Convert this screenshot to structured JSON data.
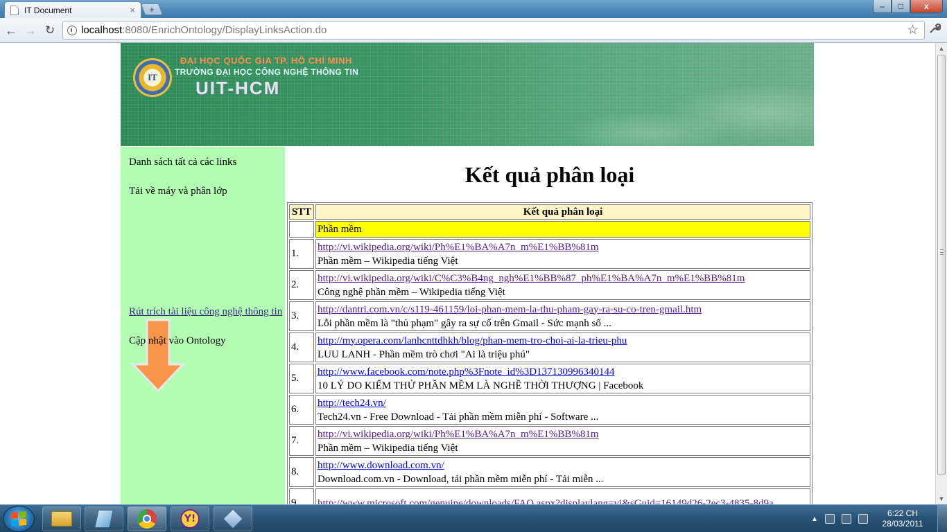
{
  "browser": {
    "tab_title": "IT Document",
    "tab_close": "×",
    "new_tab": "+",
    "window_controls": {
      "minimize": "–",
      "maximize": "□",
      "close": "x"
    },
    "nav": {
      "back": "←",
      "forward": "→",
      "reload": "↻"
    },
    "url_host": "localhost",
    "url_path": ":8080/EnrichOntology/DisplayLinksAction.do",
    "bookmark_star": "☆",
    "wrench": "🔧"
  },
  "banner": {
    "line1": "ĐẠI HỌC QUỐC GIA TP. HỒ CHÍ MINH",
    "line2": "TRƯỜNG ĐẠI HỌC CÔNG NGHỆ THÔNG TIN",
    "line3": "UIT-HCM",
    "logo_text": "IT"
  },
  "sidebar": {
    "items": [
      {
        "label": "Danh sách tất cả các links"
      },
      {
        "label": "Tải về máy và phân lớp"
      },
      {
        "label": "Rút trích tài liệu công nghệ thông tin"
      },
      {
        "label": "Cập nhật vào Ontology"
      }
    ],
    "arrow_color": "#f7954a"
  },
  "main": {
    "title": "Kết quả phân loại",
    "table": {
      "headers": [
        "STT",
        "Kết quả phân loại"
      ],
      "category": "Phần mềm",
      "rows": [
        {
          "num": "1.",
          "url": "http://vi.wikipedia.org/wiki/Ph%E1%BA%A7n_m%E1%BB%81m ",
          "desc": "Phần mềm – Wikipedia tiếng Việt"
        },
        {
          "num": "2.",
          "url": "http://vi.wikipedia.org/wiki/C%C3%B4ng_ngh%E1%BB%87_ph%E1%BA%A7n_m%E1%BB%81m ",
          "desc": "Công nghệ phần mềm – Wikipedia tiếng Việt"
        },
        {
          "num": "3.",
          "url": "http://dantri.com.vn/c/s119-461159/loi-phan-mem-la-thu-pham-gay-ra-su-co-tren-gmail.htm ",
          "desc": "Lỗi phần mềm là \"thủ phạm\" gây ra sự cố trên Gmail - Sức mạnh số ..."
        },
        {
          "num": "4.",
          "url": "http://my.opera.com/lanhcnttdhkh/blog/phan-mem-tro-choi-ai-la-trieu-phu ",
          "desc": "LUU LANH - Phần mềm trò chơi \"Ai là triệu phú\""
        },
        {
          "num": "5.",
          "url": "http://www.facebook.com/note.php%3Fnote_id%3D137130996340144 ",
          "desc": "10 LÝ DO KIỂM THỬ PHẦN MỀM LÀ NGHỀ THỜI THƯỢNG | Facebook"
        },
        {
          "num": "6.",
          "url": "http://tech24.vn/ ",
          "desc": "Tech24.vn - Free Download - Tải phần mềm miễn phí - Software ..."
        },
        {
          "num": "7.",
          "url": "http://vi.wikipedia.org/wiki/Ph%E1%BA%A7n_m%E1%BB%81m ",
          "desc": "Phần mềm – Wikipedia tiếng Việt"
        },
        {
          "num": "8.",
          "url": "http://www.download.com.vn/ ",
          "desc": "Download.com.vn - Download, tải phần mềm miễn phí - Tải miễn ..."
        },
        {
          "num": "9.",
          "url": "http://www.microsoft.com/genuine/downloads/FAQ.aspx?displaylang=vi&sGuid=16149d26-2ec3-4835-8d9a",
          "desc": ""
        }
      ]
    }
  },
  "taskbar": {
    "clock_time": "6:22 CH",
    "clock_date": "28/03/2011",
    "tray_arrow": "▲",
    "yahoo_glyph": "Y!"
  }
}
